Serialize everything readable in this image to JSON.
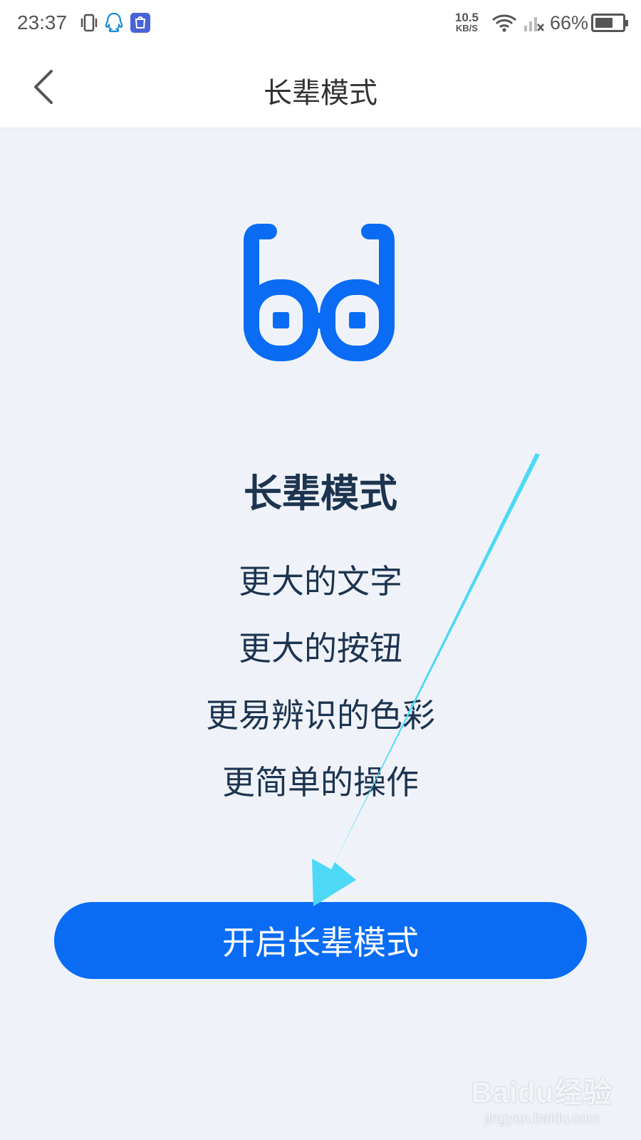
{
  "status_bar": {
    "time": "23:37",
    "net_speed_value": "10.5",
    "net_speed_unit": "KB/S",
    "battery": "66%",
    "battery_level": 0.66,
    "icons": [
      "vibrate-icon",
      "qq-icon",
      "store-app-icon",
      "wifi-icon",
      "no-signal-icon",
      "battery-icon"
    ]
  },
  "header": {
    "back_icon": "chevron-left-icon",
    "title": "长辈模式"
  },
  "hero": {
    "icon": "glasses-icon",
    "accent_color": "#0a6cf4"
  },
  "main": {
    "heading": "长辈模式",
    "features": [
      "更大的文字",
      "更大的按钮",
      "更易辨识的色彩",
      "更简单的操作"
    ],
    "enable_button_label": "开启长辈模式"
  },
  "annotation": {
    "arrow_color": "#4dd9f5"
  },
  "watermark": {
    "logo": "Baidu经验",
    "url": "jingyan.baidu.com"
  }
}
